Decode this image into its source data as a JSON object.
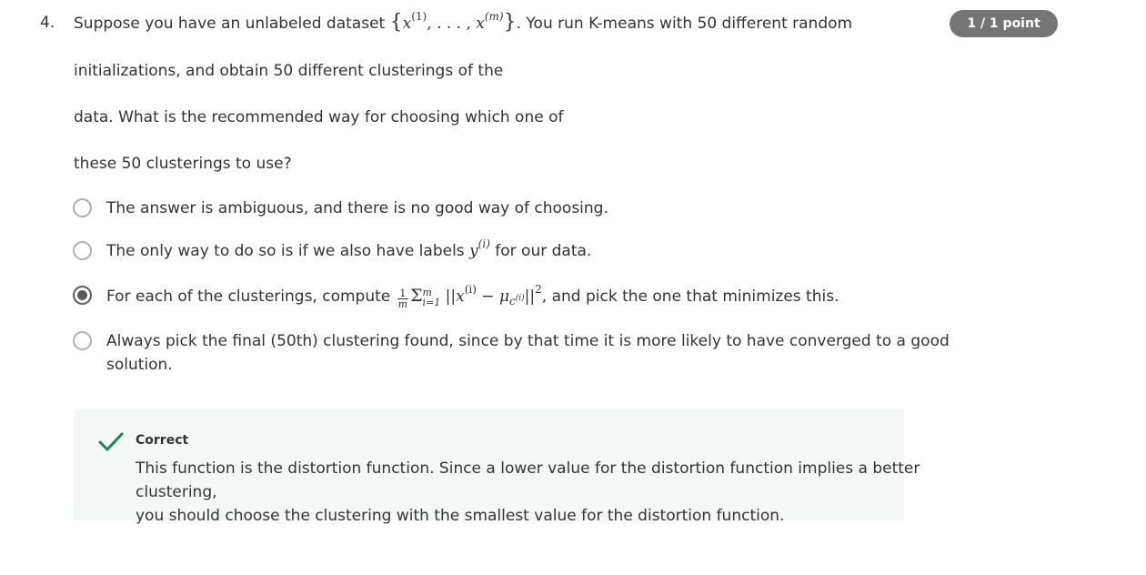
{
  "question": {
    "number": "4.",
    "points": "1 / 1 point",
    "lines": {
      "l1_pre": "Suppose you have an unlabeled dataset ",
      "l1_brace_open": "{",
      "l1_x": "x",
      "l1_sup1": "(1)",
      "l1_dots": ", . . . , ",
      "l1_x2": "x",
      "l1_sup2": "(m)",
      "l1_brace_close": "}",
      "l1_post": ". You run K-means with 50 different random",
      "l2": "initializations, and obtain 50 different clusterings of the",
      "l3": "data. What is the recommended way for choosing which one of",
      "l4": "these 50 clusterings to use?"
    }
  },
  "options": [
    {
      "text": "The answer is ambiguous, and there is no good way of choosing.",
      "selected": false
    },
    {
      "text_pre": "The only way to do so is if we also have labels ",
      "var": "y",
      "sup": "(i)",
      "text_post": " for our data.",
      "selected": false
    },
    {
      "text_pre": "For each of the clusterings, compute ",
      "frac_num": "1",
      "frac_den": "m",
      "sum": "Σ",
      "sum_top": "m",
      "sum_bottom": "i=1",
      "norm_open": " ||",
      "x": "x",
      "x_sup": "(i)",
      "minus": " − ",
      "mu": "μ",
      "mu_sub": "c",
      "mu_sub_sup": "(i)",
      "norm_close": "||",
      "sq": "2",
      "text_post": ", and pick the one that minimizes this.",
      "selected": true
    },
    {
      "line1": "Always pick the final (50th) clustering found, since by that time it is more likely to have converged to a good",
      "line2": "solution.",
      "selected": false
    }
  ],
  "feedback": {
    "status": "Correct",
    "line1": "This function is the distortion function. Since a lower value for the distortion function implies a better clustering,",
    "line2": "you should choose the clustering with the smallest value for the distortion function.",
    "icon": "checkmark-icon",
    "check_color": "#1f8354",
    "background": "#f3f8f6"
  }
}
